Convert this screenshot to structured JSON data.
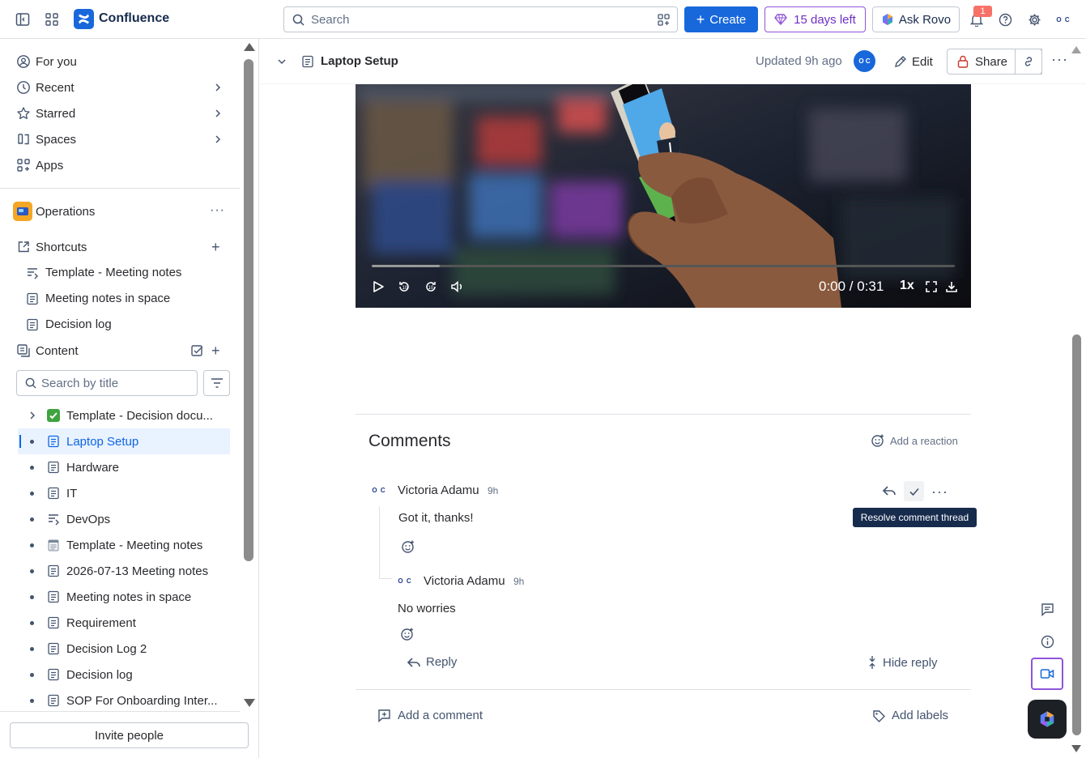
{
  "topbar": {
    "brand": "Confluence",
    "search_placeholder": "Search",
    "create_label": "Create",
    "trial_label": "15 days left",
    "rovo_label": "Ask Rovo",
    "notification_count": "1",
    "avatar_initials": "O C"
  },
  "sidebar": {
    "nav": [
      {
        "label": "For you"
      },
      {
        "label": "Recent"
      },
      {
        "label": "Starred"
      },
      {
        "label": "Spaces"
      },
      {
        "label": "Apps"
      }
    ],
    "space_name": "Operations",
    "shortcuts_label": "Shortcuts",
    "shortcuts": [
      {
        "label": "Template - Meeting notes"
      },
      {
        "label": "Meeting notes in space"
      },
      {
        "label": "Decision log"
      }
    ],
    "content_label": "Content",
    "search_placeholder": "Search by title",
    "tree": [
      {
        "label": "Template - Decision docu..."
      },
      {
        "label": "Laptop Setup"
      },
      {
        "label": "Hardware"
      },
      {
        "label": "IT"
      },
      {
        "label": "DevOps"
      },
      {
        "label": "Template - Meeting notes"
      },
      {
        "label": "2026-07-13 Meeting notes"
      },
      {
        "label": "Meeting notes in space"
      },
      {
        "label": "Requirement"
      },
      {
        "label": "Decision Log 2"
      },
      {
        "label": "Decision log"
      },
      {
        "label": "SOP For Onboarding Inter..."
      }
    ],
    "invite_label": "Invite people"
  },
  "page": {
    "title": "Laptop Setup",
    "updated": "Updated 9h ago",
    "edit_label": "Edit",
    "share_label": "Share"
  },
  "video": {
    "time": "0:00 / 0:31",
    "speed": "1x",
    "progress": 0
  },
  "comments": {
    "title": "Comments",
    "add_reaction": "Add a reaction",
    "thread": {
      "author": "Victoria Adamu",
      "time": "9h",
      "text": "Got it, thanks!",
      "tooltip": "Resolve comment thread",
      "reply": {
        "author": "Victoria Adamu",
        "time": "9h",
        "text": "No worries"
      },
      "reply_label": "Reply",
      "hide_reply_label": "Hide reply"
    },
    "add_comment": "Add a comment",
    "add_labels": "Add labels"
  },
  "colors": {
    "brand_blue": "#1868db",
    "trial_purple": "#8f54d9",
    "active_bg": "#e9f2ff"
  }
}
